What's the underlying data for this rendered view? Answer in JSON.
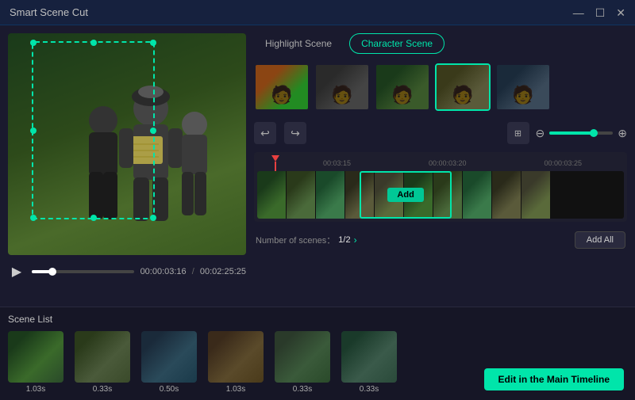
{
  "titleBar": {
    "title": "Smart Scene Cut",
    "minBtn": "—",
    "maxBtn": "☐",
    "closeBtn": "✕"
  },
  "tabs": {
    "items": [
      {
        "id": "highlight",
        "label": "Highlight Scene",
        "active": false
      },
      {
        "id": "character",
        "label": "Character Scene",
        "active": true
      }
    ]
  },
  "thumbnails": [
    {
      "id": 1,
      "selected": false
    },
    {
      "id": 2,
      "selected": false
    },
    {
      "id": 3,
      "selected": false
    },
    {
      "id": 4,
      "selected": true
    },
    {
      "id": 5,
      "selected": false
    }
  ],
  "toolbar": {
    "undoLabel": "↩",
    "redoLabel": "↪",
    "fitLabel": "⊞",
    "zoomMinusLabel": "⊖",
    "zoomPlusLabel": "⊕"
  },
  "timeline": {
    "markers": [
      "00:03:15",
      "00:00:03:20",
      "00:00:03:25"
    ],
    "addBtnLabel": "Add"
  },
  "scenesInfo": {
    "label": "Number of scenes：",
    "count": "1/2",
    "arrowLabel": "›",
    "addAllLabel": "Add All"
  },
  "videoControls": {
    "playLabel": "▶",
    "currentTime": "00:00:03:16",
    "separator": "/",
    "totalTime": "00:02:25:25"
  },
  "sceneList": {
    "title": "Scene List",
    "items": [
      {
        "id": 1,
        "duration": "1.03s"
      },
      {
        "id": 2,
        "duration": "0.33s"
      },
      {
        "id": 3,
        "duration": "0.50s"
      },
      {
        "id": 4,
        "duration": "1.03s"
      },
      {
        "id": 5,
        "duration": "0.33s"
      }
    ]
  },
  "editButton": {
    "label": "Edit in the Main Timeline"
  }
}
